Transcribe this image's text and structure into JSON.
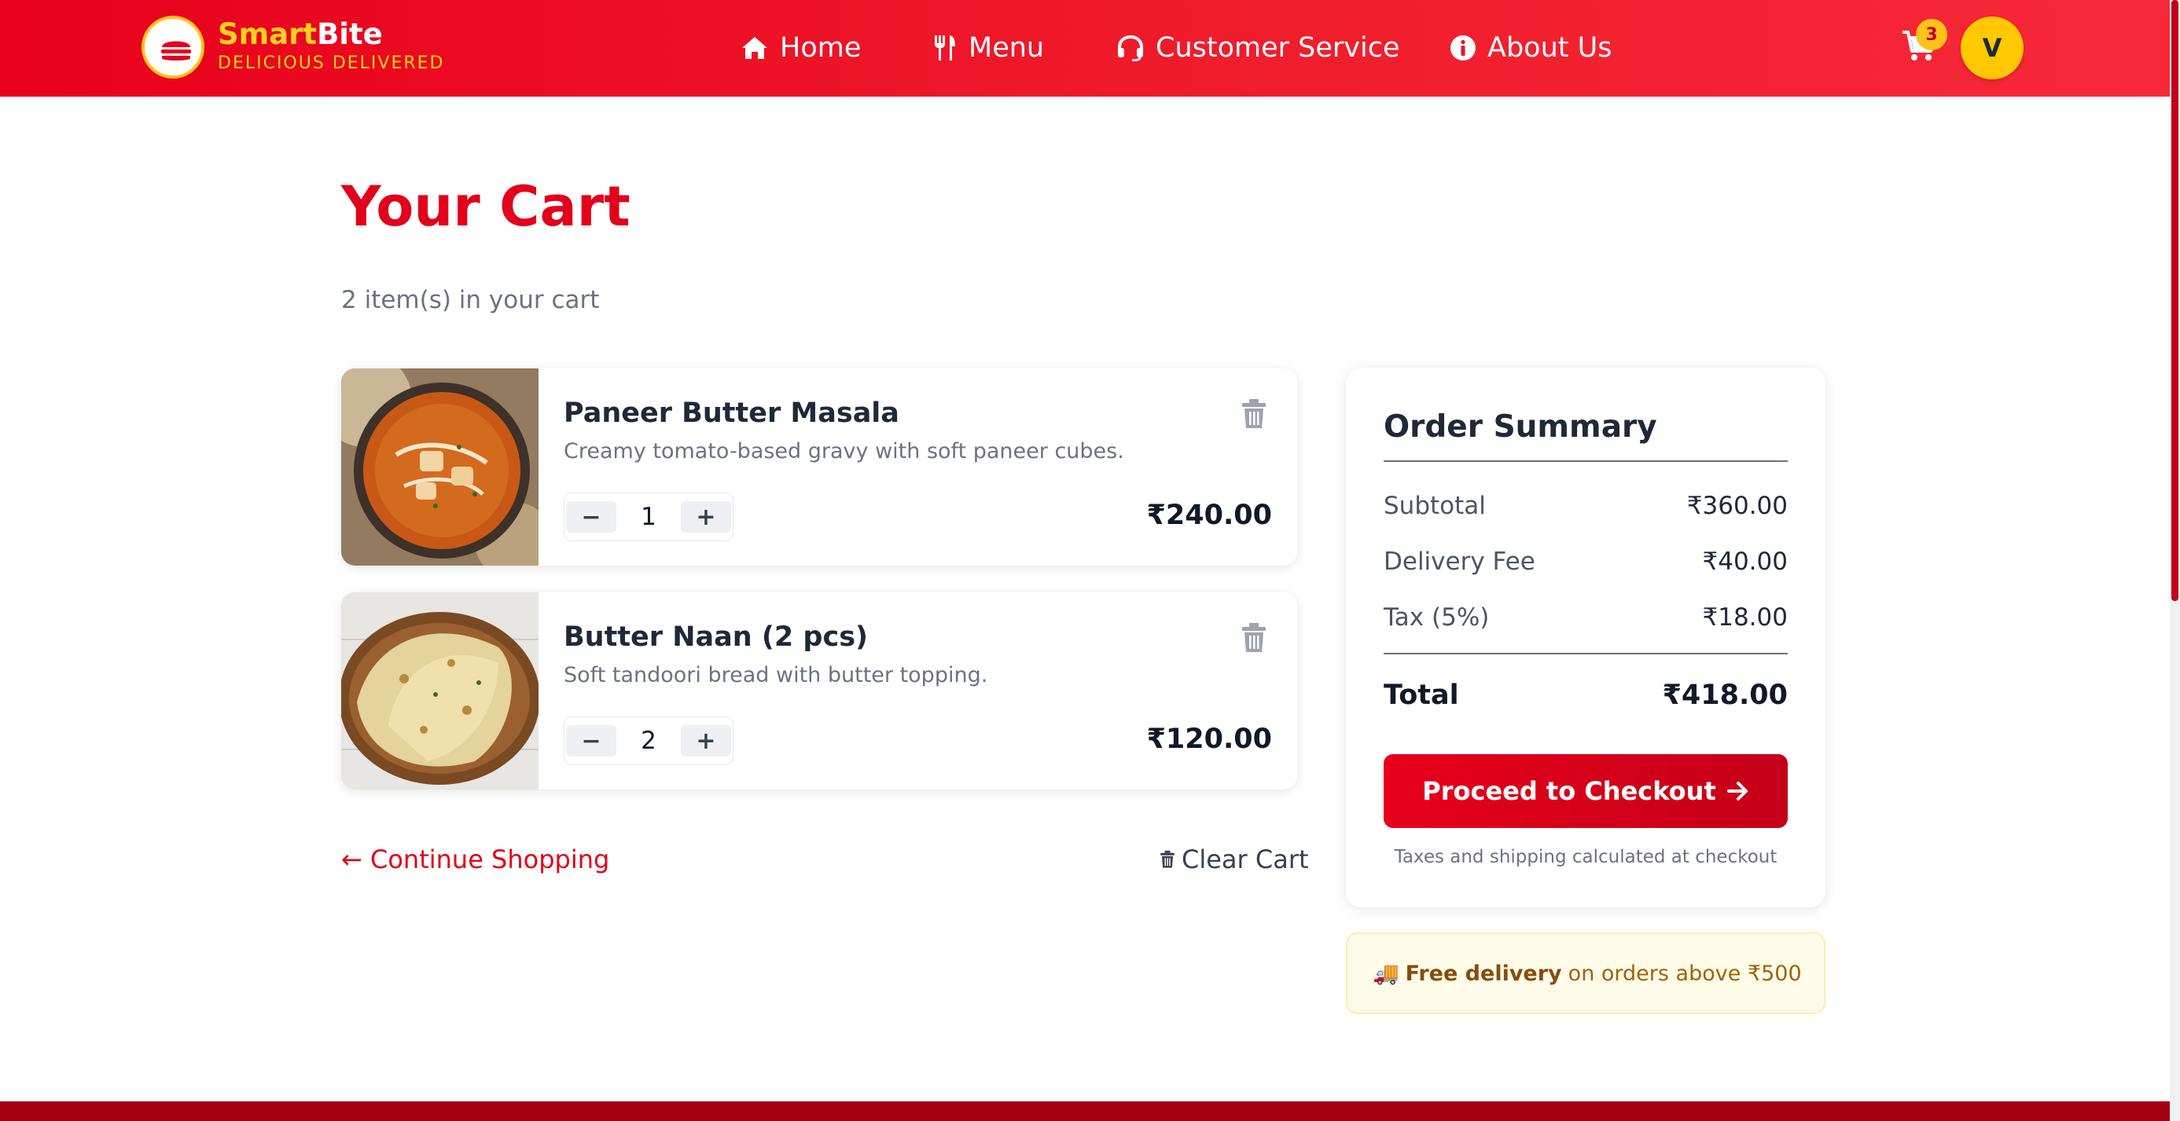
{
  "brand": {
    "name_part1": "Smart",
    "name_part2": "Bite",
    "tagline": "DELICIOUS DELIVERED",
    "colors": {
      "primary": "#e3001b",
      "accent": "#ffc21a"
    }
  },
  "nav": [
    {
      "label": "Home",
      "icon": "home-icon"
    },
    {
      "label": "Menu",
      "icon": "utensils-icon"
    },
    {
      "label": "Customer Service",
      "icon": "headset-icon"
    },
    {
      "label": "About Us",
      "icon": "info-icon"
    }
  ],
  "header": {
    "cart_count": "3",
    "avatar_initial": "V"
  },
  "page": {
    "title": "Your Cart",
    "item_count": "2 item(s) in your cart"
  },
  "cart": {
    "items": [
      {
        "name": "Paneer Butter Masala",
        "description": "Creamy tomato-based gravy with soft paneer cubes.",
        "quantity": "1",
        "price": "₹240.00"
      },
      {
        "name": "Butter Naan (2 pcs)",
        "description": "Soft tandoori bread with butter topping.",
        "quantity": "2",
        "price": "₹120.00"
      }
    ],
    "minus_symbol": "−",
    "plus_symbol": "+",
    "continue_label": "← Continue Shopping",
    "clear_label": "Clear Cart"
  },
  "summary": {
    "title": "Order Summary",
    "rows": [
      {
        "label": "Subtotal",
        "value": "₹360.00"
      },
      {
        "label": "Delivery Fee",
        "value": "₹40.00"
      },
      {
        "label": "Tax (5%)",
        "value": "₹18.00"
      }
    ],
    "total_label": "Total",
    "total_value": "₹418.00",
    "checkout_label": "Proceed to Checkout",
    "note": "Taxes and shipping calculated at checkout"
  },
  "promo": {
    "icon": "🚚",
    "bold": "Free delivery",
    "text": "on orders above ₹500"
  }
}
